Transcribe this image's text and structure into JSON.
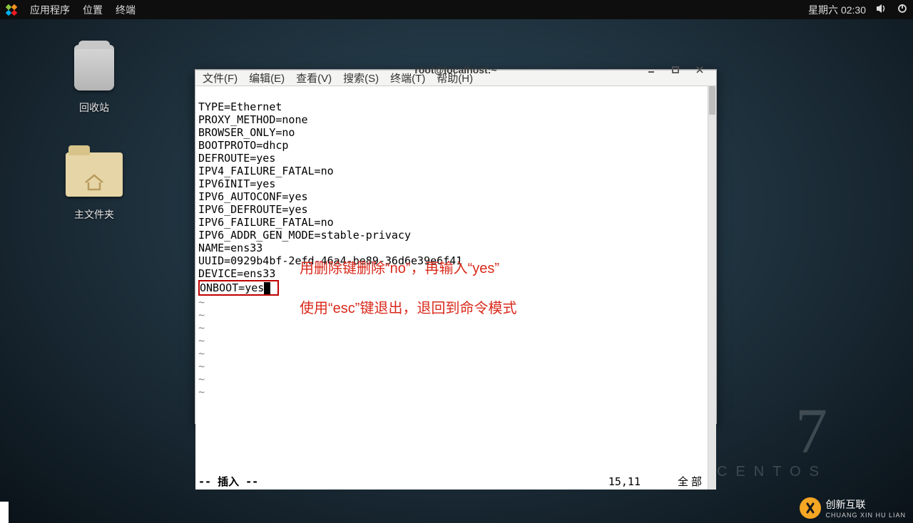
{
  "topbar": {
    "menu": {
      "applications": "应用程序",
      "places": "位置",
      "terminal": "终端"
    },
    "clock": "星期六 02:30"
  },
  "desktop": {
    "trash_label": "回收站",
    "home_label": "主文件夹"
  },
  "window": {
    "title": "root@localhost:~",
    "menu": {
      "file": "文件(F)",
      "edit": "编辑(E)",
      "view": "查看(V)",
      "search": "搜索(S)",
      "terminal": "终端(T)",
      "help": "帮助(H)"
    }
  },
  "terminal": {
    "lines": [
      "TYPE=Ethernet",
      "PROXY_METHOD=none",
      "BROWSER_ONLY=no",
      "BOOTPROTO=dhcp",
      "DEFROUTE=yes",
      "IPV4_FAILURE_FATAL=no",
      "IPV6INIT=yes",
      "IPV6_AUTOCONF=yes",
      "IPV6_DEFROUTE=yes",
      "IPV6_FAILURE_FATAL=no",
      "IPV6_ADDR_GEN_MODE=stable-privacy",
      "NAME=ens33",
      "UUID=0929b4bf-2efd-46a4-be89-36d6e39e6f41",
      "DEVICE=ens33"
    ],
    "boxed_line": "ONBOOT=yes",
    "status_mode": "-- 插入 --",
    "status_pos": "15,11",
    "status_pct": "全部"
  },
  "annotations": {
    "a1": "用删除键删除“no”，再输入“yes”",
    "a2": "使用“esc”键退出，退回到命令模式"
  },
  "branding": {
    "seven": "7",
    "centos": "CENTOS",
    "watermark_cn": "创新互联",
    "watermark_py": "CHUANG XIN HU LIAN"
  }
}
